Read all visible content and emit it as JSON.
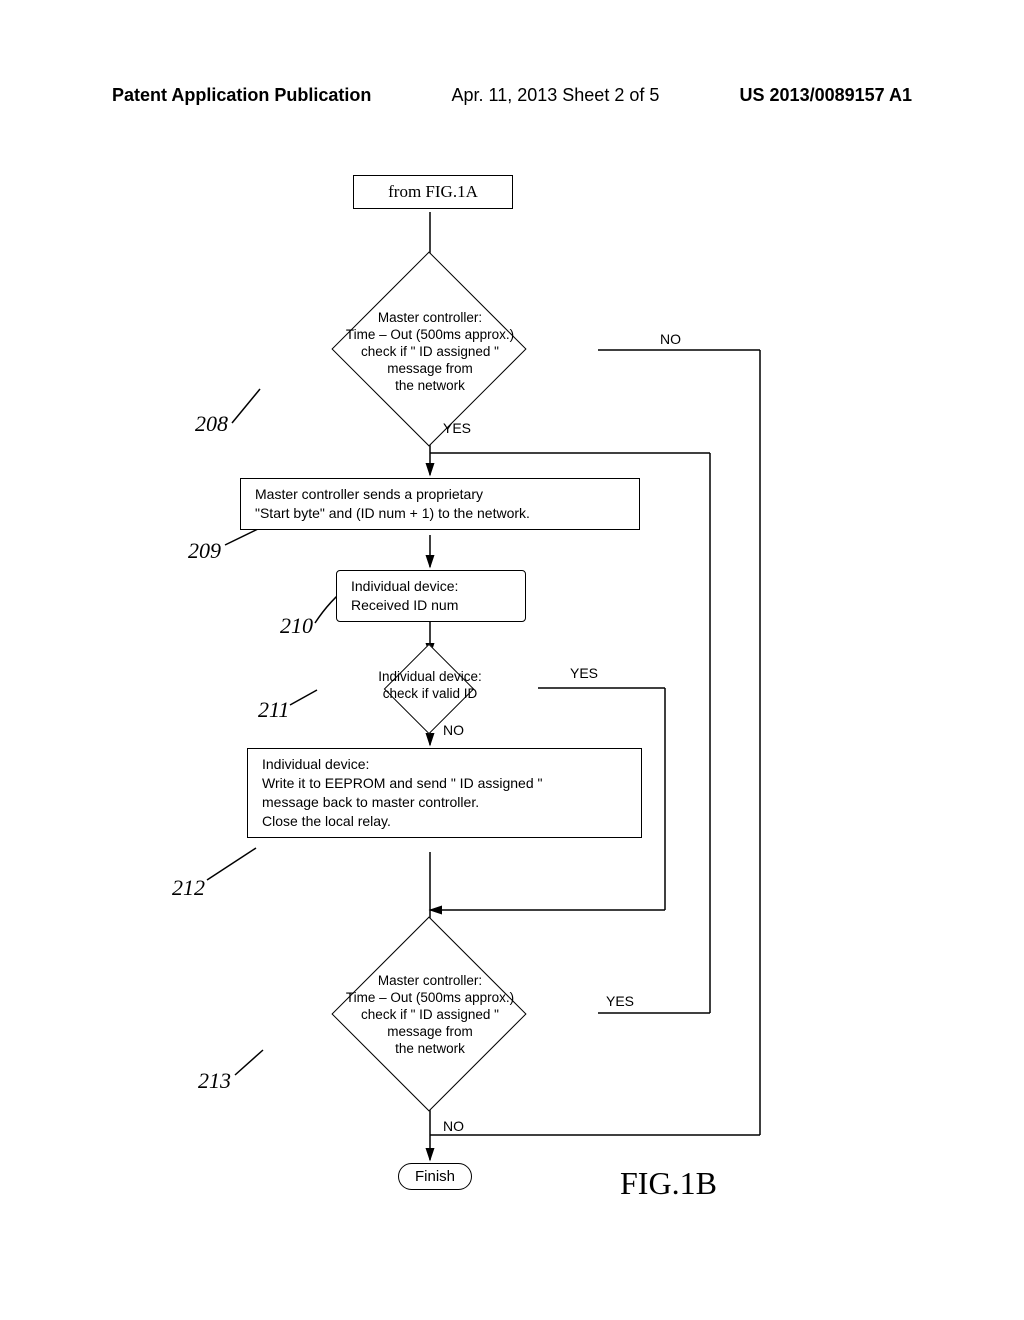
{
  "header": {
    "left": "Patent Application Publication",
    "center": "Apr. 11, 2013  Sheet 2 of 5",
    "right": "US 2013/0089157 A1"
  },
  "boxes": {
    "from": "from FIG.1A",
    "d208_l1": "Master controller:",
    "d208_l2": "Time – Out (500ms approx.)",
    "d208_l3": "check if \" ID assigned \"",
    "d208_l4": "message from",
    "d208_l5": "the network",
    "p209_l1": "Master controller sends a proprietary",
    "p209_l2": "\"Start byte\" and (ID num + 1) to the network.",
    "p210_l1": "Individual device:",
    "p210_l2": "Received ID num",
    "d211_l1": "Individual device:",
    "d211_l2": "check if valid ID",
    "p212_l1": "Individual device:",
    "p212_l2": "Write it to EEPROM and send \" ID assigned \"",
    "p212_l3": "message back to master controller.",
    "p212_l4": "Close the local relay.",
    "d213_l1": "Master controller:",
    "d213_l2": "Time – Out (500ms approx.)",
    "d213_l3": "check if \" ID assigned \"",
    "d213_l4": "message from",
    "d213_l5": "the network",
    "finish": "Finish"
  },
  "labels": {
    "no_208": "NO",
    "yes_208": "YES",
    "yes_211": "YES",
    "no_211": "NO",
    "yes_213": "YES",
    "no_213": "NO"
  },
  "refs": {
    "r208": "208",
    "r209": "209",
    "r210": "210",
    "r211": "211",
    "r212": "212",
    "r213": "213"
  },
  "figure": "FIG.1B"
}
